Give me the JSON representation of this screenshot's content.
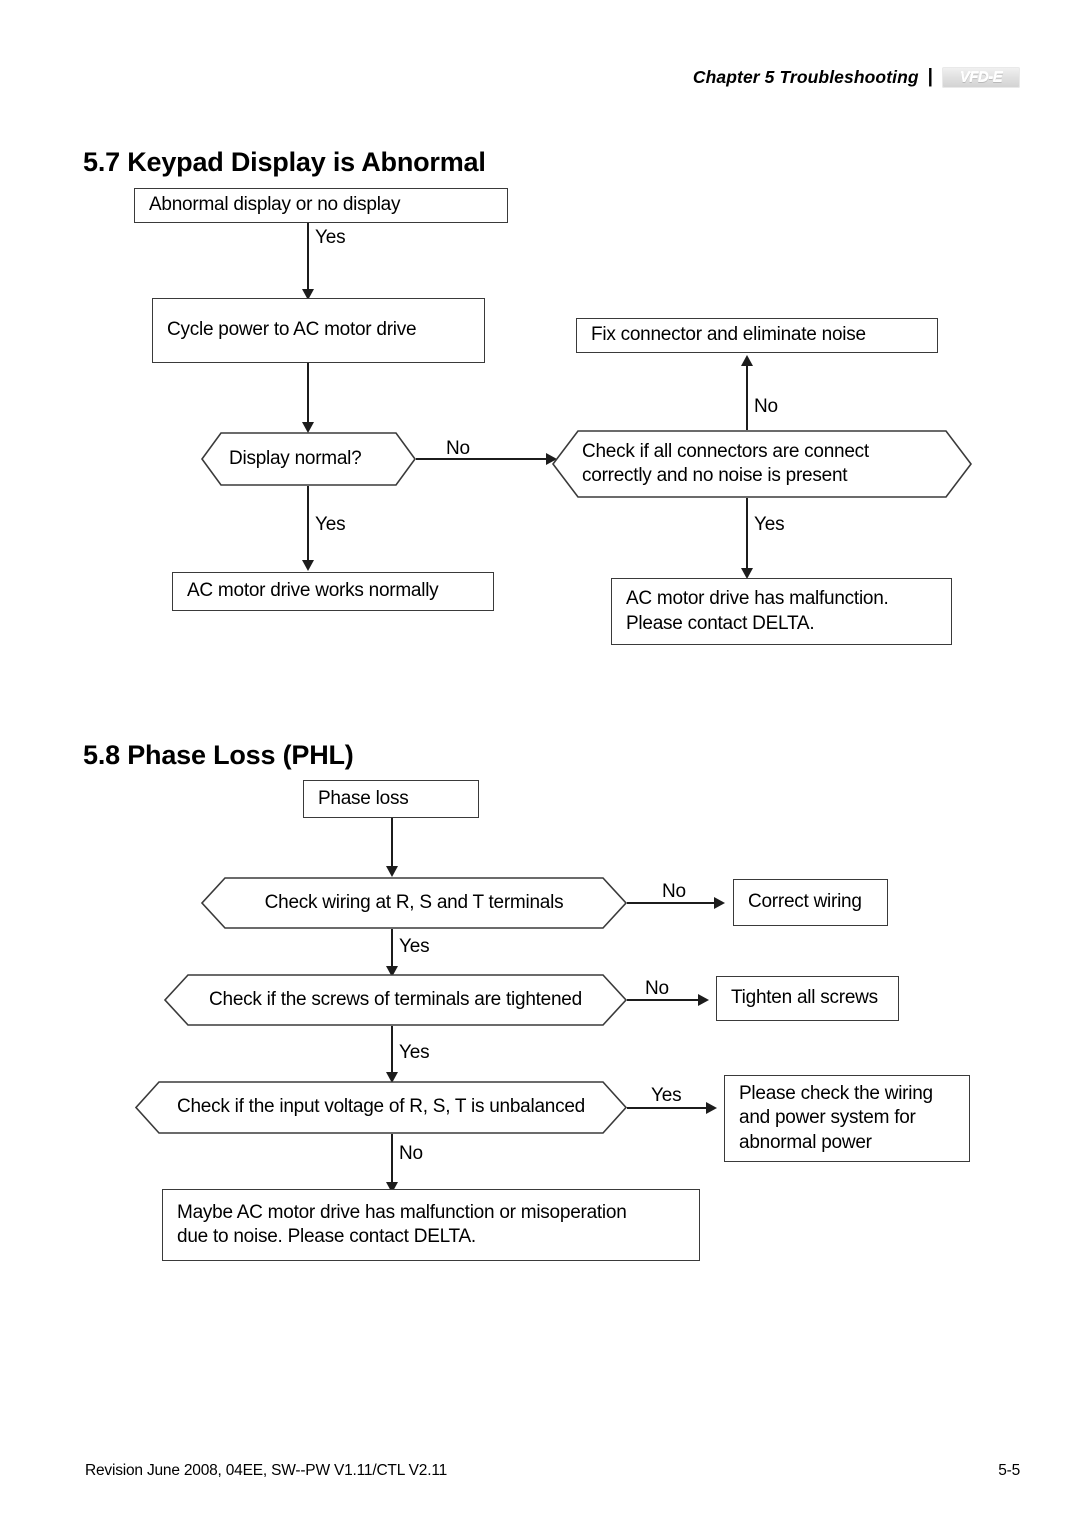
{
  "header": {
    "chapter": "Chapter 5 Troubleshooting",
    "divider": "|",
    "logo_text": "VFD-E",
    "logo_name": "vfd-e-logo"
  },
  "sections": [
    {
      "heading": "5.7 Keypad Display is Abnormal",
      "flowchart": {
        "nodes": [
          {
            "id": "abnormal-display",
            "shape": "box",
            "text": "Abnormal display or no display"
          },
          {
            "id": "cycle-power",
            "shape": "box",
            "text": "Cycle power to AC motor drive"
          },
          {
            "id": "display-normal",
            "shape": "hexagon",
            "text": "Display normal?"
          },
          {
            "id": "works-normally",
            "shape": "box",
            "text": "AC motor drive works normally"
          },
          {
            "id": "fix-connector",
            "shape": "box",
            "text": "Fix connector and eliminate noise"
          },
          {
            "id": "check-connectors",
            "shape": "hexagon",
            "line1": "Check if all connectors are connect",
            "line2": "correctly and no noise is present"
          },
          {
            "id": "has-malfunction",
            "shape": "box",
            "line1": "AC motor drive has malfunction.",
            "line2": "Please contact DELTA."
          }
        ],
        "edges": [
          {
            "from": "abnormal-display",
            "to": "cycle-power",
            "label": "Yes"
          },
          {
            "from": "cycle-power",
            "to": "display-normal",
            "label": ""
          },
          {
            "from": "display-normal",
            "to": "works-normally",
            "label": "Yes"
          },
          {
            "from": "display-normal",
            "to": "check-connectors",
            "label": "No"
          },
          {
            "from": "check-connectors",
            "to": "fix-connector",
            "label": "No"
          },
          {
            "from": "check-connectors",
            "to": "has-malfunction",
            "label": "Yes"
          }
        ]
      }
    },
    {
      "heading": "5.8 Phase Loss (PHL)",
      "flowchart": {
        "nodes": [
          {
            "id": "phase-loss",
            "shape": "box",
            "text": "Phase loss"
          },
          {
            "id": "check-wiring",
            "shape": "hexagon",
            "text": "Check wiring at R, S and T terminals"
          },
          {
            "id": "correct-wiring",
            "shape": "box",
            "text": "Correct wiring"
          },
          {
            "id": "check-screws",
            "shape": "hexagon",
            "text": "Check if the screws of terminals are tightened"
          },
          {
            "id": "tighten-screws",
            "shape": "box",
            "text": "Tighten all screws"
          },
          {
            "id": "check-voltage",
            "shape": "hexagon",
            "text": "Check if the input voltage of R, S, T is unbalanced"
          },
          {
            "id": "check-power-system",
            "shape": "box",
            "line1": "Please check the wiring",
            "line2": "and power system for",
            "line3": "abnormal power"
          },
          {
            "id": "maybe-malfunction",
            "shape": "box",
            "line1": "Maybe AC motor drive has malfunction or misoperation",
            "line2": "due to noise. Please contact DELTA."
          }
        ],
        "edges": [
          {
            "from": "phase-loss",
            "to": "check-wiring",
            "label": ""
          },
          {
            "from": "check-wiring",
            "to": "correct-wiring",
            "label": "No"
          },
          {
            "from": "check-wiring",
            "to": "check-screws",
            "label": "Yes"
          },
          {
            "from": "check-screws",
            "to": "tighten-screws",
            "label": "No"
          },
          {
            "from": "check-screws",
            "to": "check-voltage",
            "label": "Yes"
          },
          {
            "from": "check-voltage",
            "to": "check-power-system",
            "label": "Yes"
          },
          {
            "from": "check-voltage",
            "to": "maybe-malfunction",
            "label": "No"
          }
        ]
      }
    }
  ],
  "footer": {
    "revision": "Revision June 2008, 04EE, SW--PW V1.11/CTL V2.11",
    "page": "5-5"
  },
  "colors": {
    "text": "#000000",
    "stroke": "#3a3a3a",
    "line": "#1c1c1c",
    "background": "#ffffff"
  }
}
